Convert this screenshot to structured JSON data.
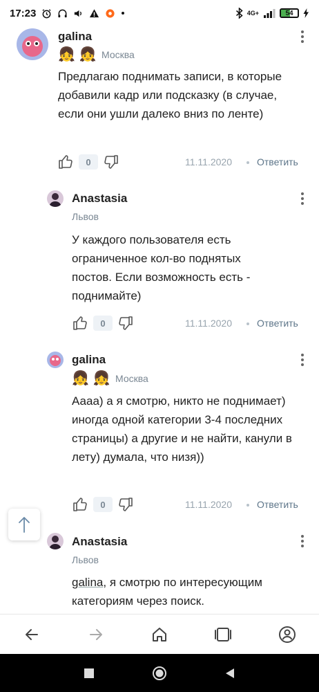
{
  "status_bar": {
    "time": "17:23",
    "network": "4G+",
    "battery": "54",
    "battery_level": 0.54
  },
  "comments": [
    {
      "author": "galina",
      "location": "Москва",
      "badges": [
        "👧",
        "👧"
      ],
      "text": "Предлагаю поднимать записи, в которые добавили кадр или подсказку (в случае, если они ушли далеко вниз по ленте)",
      "likes": "0",
      "date": "11.11.2020",
      "reply_label": "Ответить"
    },
    {
      "author": "Anastasia",
      "location": "Львов",
      "text": "У каждого пользователя есть ограниченное кол-во поднятых постов. Если возможность есть - поднимайте)",
      "likes": "0",
      "date": "11.11.2020",
      "reply_label": "Ответить"
    },
    {
      "author": "galina",
      "location": "Москва",
      "badges": [
        "👧",
        "👧"
      ],
      "text": "Аааа) а я смотрю, никто не поднимает) иногда одной категории 3-4 последних страницы) а другие и не найти, канули в лету) думала, что низя))",
      "likes": "0",
      "date": "11.11.2020",
      "reply_label": "Ответить"
    },
    {
      "author": "Anastasia",
      "location": "Львов",
      "mention": "galina",
      "text": ", я смотрю по интересующим категориям через поиск."
    }
  ],
  "icons": {
    "scroll_up": "arrow-up-icon",
    "back": "arrow-left-icon",
    "forward": "arrow-right-icon",
    "home": "home-icon",
    "tabs": "tabs-icon",
    "profile": "profile-icon"
  },
  "colors": {
    "link": "#5d7589",
    "meta": "#98a4ae",
    "count_bg": "#eef2f6"
  }
}
